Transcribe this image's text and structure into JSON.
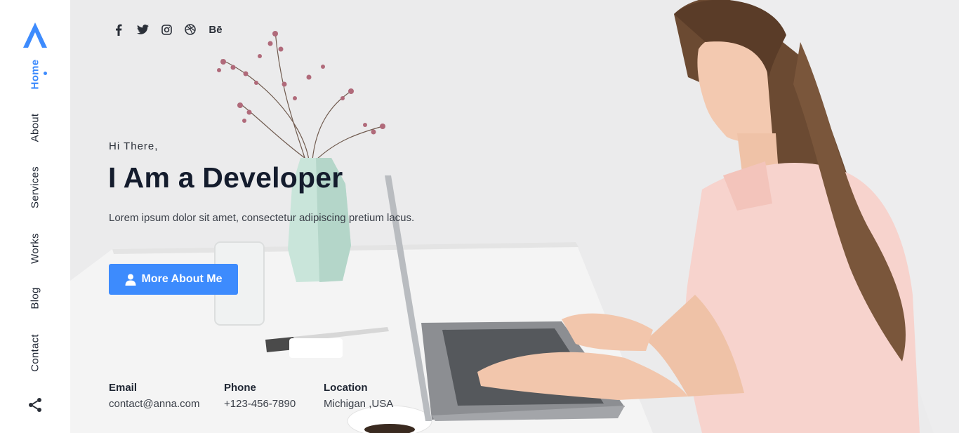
{
  "sidebar": {
    "logo_icon": "triangle-a-logo",
    "nav": [
      {
        "label": "Home",
        "active": true
      },
      {
        "label": "About",
        "active": false
      },
      {
        "label": "Services",
        "active": false
      },
      {
        "label": "Works",
        "active": false
      },
      {
        "label": "Blog",
        "active": false
      },
      {
        "label": "Contact",
        "active": false
      }
    ],
    "share_icon": "share-icon"
  },
  "socials": {
    "icons": [
      "facebook-icon",
      "twitter-icon",
      "instagram-icon",
      "dribbble-icon",
      "behance-icon"
    ],
    "behance_label": "Bē"
  },
  "hero": {
    "greeting": "Hi There,",
    "headline": "I Am a Developer",
    "intro": "Lorem ipsum dolor sit amet, consectetur adipiscing pretium lacus.",
    "button_label": "More About Me",
    "button_icon": "user-icon"
  },
  "contacts": [
    {
      "label": "Email",
      "value": "contact@anna.com"
    },
    {
      "label": "Phone",
      "value": "+123-456-7890"
    },
    {
      "label": "Location",
      "value": "Michigan ,USA"
    }
  ],
  "colors": {
    "accent": "#3d8bfd",
    "heading": "#141c2d",
    "text": "#3a3f48"
  }
}
